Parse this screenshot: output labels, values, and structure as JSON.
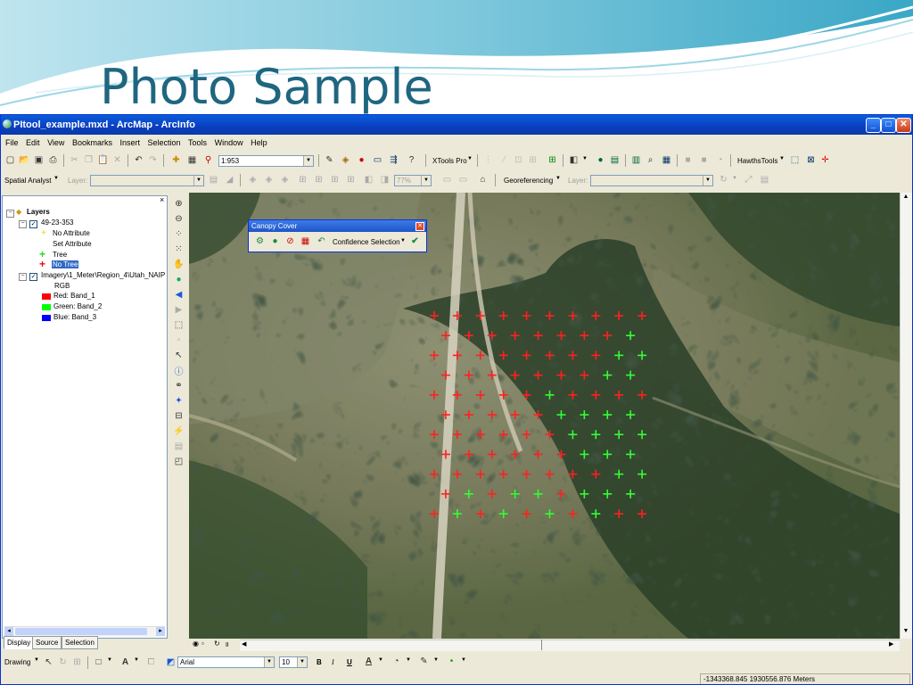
{
  "slide": {
    "title": "Photo Sample"
  },
  "window": {
    "title": "PItool_example.mxd - ArcMap - ArcInfo",
    "controls": [
      "_",
      "□",
      "✕"
    ]
  },
  "menu": [
    "File",
    "Edit",
    "View",
    "Bookmarks",
    "Insert",
    "Selection",
    "Tools",
    "Window",
    "Help"
  ],
  "standard_toolbar": {
    "scale": "1:953",
    "xtools_label": "XTools Pro",
    "hawths_label": "HawthsTools"
  },
  "second_toolbar": {
    "spatial_analyst": "Spatial Analyst",
    "layer_label": "Layer:",
    "layer_value": "",
    "transparency": "77%",
    "georeferencing": "Georeferencing",
    "geo_layer_label": "Layer:",
    "geo_layer_value": ""
  },
  "toc": {
    "root": "Layers",
    "layers": [
      {
        "name": "49-23-353",
        "checked": true
      },
      {
        "name": "No Attribute",
        "symbol": "yellow-plus"
      },
      {
        "name": "Set Attribute",
        "symbol": "none"
      },
      {
        "name": "Tree",
        "symbol": "green-plus"
      },
      {
        "name": "No Tree",
        "symbol": "red-plus",
        "selected": true
      },
      {
        "name": "Imagery\\1_Meter\\Region_4\\Utah_NAIP",
        "checked": true
      },
      {
        "name": "RGB",
        "symbol": "none"
      },
      {
        "name": "Red:   Band_1",
        "color": "#ff0000"
      },
      {
        "name": "Green: Band_2",
        "color": "#00ff00"
      },
      {
        "name": "Blue:   Band_3",
        "color": "#0000ff"
      }
    ],
    "tabs": [
      "Display",
      "Source",
      "Selection"
    ]
  },
  "canopy_toolbar": {
    "title": "Canopy Cover",
    "confidence_label": "Confidence Selection"
  },
  "sample_grid": {
    "legend": {
      "tree": "#33ff33",
      "no_tree": "#ff2020"
    },
    "rows": [
      "NNNNNNNNNN",
      "NNNNNNNNT",
      "NNNNNNNNTT",
      "NNNNNNNTT",
      "NNNNNTNNNN",
      "NNNNNTTTT",
      "NNNNNNTTTT",
      "NNNNNNTTT",
      "NNNNNNNNTT",
      "NTNTTNTTT",
      "NTNTNTNTNN"
    ]
  },
  "drawing_toolbar": {
    "drawing_label": "Drawing",
    "font": "Arial",
    "size": "10",
    "bold": "B",
    "italic": "I",
    "underline": "U"
  },
  "status": {
    "coords": "-1343368.845  1930556.876 Meters"
  }
}
